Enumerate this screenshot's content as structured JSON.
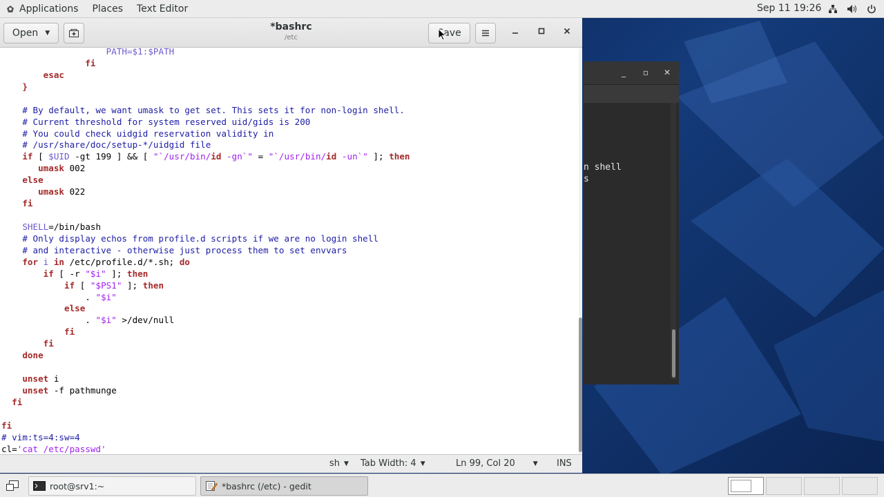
{
  "topbar": {
    "menus": [
      "Applications",
      "Places",
      "Text Editor"
    ],
    "clock": "Sep 11 19:26",
    "tray_icons": [
      "network-icon",
      "volume-icon",
      "power-icon"
    ]
  },
  "gedit": {
    "open_label": "Open",
    "save_label": "Save",
    "title": "*bashrc",
    "subtitle": "/etc",
    "lines": [
      {
        "indent": "                    ",
        "parts": [
          {
            "t": "PATH=",
            "c": "var"
          },
          {
            "t": "$1",
            "c": "var"
          },
          {
            "t": ":",
            "c": "var"
          },
          {
            "t": "$PATH",
            "c": "var"
          }
        ]
      },
      {
        "indent": "                ",
        "parts": [
          {
            "t": "fi",
            "c": "kw"
          }
        ]
      },
      {
        "indent": "        ",
        "parts": [
          {
            "t": "esac",
            "c": "kw"
          }
        ]
      },
      {
        "indent": "    ",
        "parts": [
          {
            "t": "}",
            "c": "kw"
          }
        ]
      },
      {
        "indent": "",
        "parts": []
      },
      {
        "indent": "    ",
        "parts": [
          {
            "t": "# By default, we want umask to get set. This sets it for non-login shell.",
            "c": "cm"
          }
        ]
      },
      {
        "indent": "    ",
        "parts": [
          {
            "t": "# Current threshold for system reserved uid/gids is 200",
            "c": "cm"
          }
        ]
      },
      {
        "indent": "    ",
        "parts": [
          {
            "t": "# You could check uidgid reservation validity in",
            "c": "cm"
          }
        ]
      },
      {
        "indent": "    ",
        "parts": [
          {
            "t": "# /usr/share/doc/setup-*/uidgid file",
            "c": "cm"
          }
        ]
      },
      {
        "indent": "    ",
        "parts": [
          {
            "t": "if",
            "c": "kw"
          },
          {
            "t": " [ ",
            "c": ""
          },
          {
            "t": "$UID",
            "c": "var"
          },
          {
            "t": " -gt 199 ] && [ ",
            "c": ""
          },
          {
            "t": "\"`/usr/bin/",
            "c": "str"
          },
          {
            "t": "id",
            "c": "kw"
          },
          {
            "t": " -gn`\"",
            "c": "str"
          },
          {
            "t": " = ",
            "c": ""
          },
          {
            "t": "\"`/usr/bin/",
            "c": "str"
          },
          {
            "t": "id",
            "c": "kw"
          },
          {
            "t": " -un`\"",
            "c": "str"
          },
          {
            "t": " ]; ",
            "c": ""
          },
          {
            "t": "then",
            "c": "kw"
          }
        ]
      },
      {
        "indent": "       ",
        "parts": [
          {
            "t": "umask",
            "c": "kw"
          },
          {
            "t": " 002",
            "c": ""
          }
        ]
      },
      {
        "indent": "    ",
        "parts": [
          {
            "t": "else",
            "c": "kw"
          }
        ]
      },
      {
        "indent": "       ",
        "parts": [
          {
            "t": "umask",
            "c": "kw"
          },
          {
            "t": " 022",
            "c": ""
          }
        ]
      },
      {
        "indent": "    ",
        "parts": [
          {
            "t": "fi",
            "c": "kw"
          }
        ]
      },
      {
        "indent": "",
        "parts": []
      },
      {
        "indent": "    ",
        "parts": [
          {
            "t": "SHELL",
            "c": "var"
          },
          {
            "t": "=/bin/bash",
            "c": ""
          }
        ]
      },
      {
        "indent": "    ",
        "parts": [
          {
            "t": "# Only display echos from profile.d scripts if we are no login shell",
            "c": "cm"
          }
        ]
      },
      {
        "indent": "    ",
        "parts": [
          {
            "t": "# and interactive - otherwise just process them to set envvars",
            "c": "cm"
          }
        ]
      },
      {
        "indent": "    ",
        "parts": [
          {
            "t": "for",
            "c": "kw"
          },
          {
            "t": " i ",
            "c": "var"
          },
          {
            "t": "in",
            "c": "kw"
          },
          {
            "t": " /etc/profile.d/*.sh; ",
            "c": ""
          },
          {
            "t": "do",
            "c": "kw"
          }
        ]
      },
      {
        "indent": "        ",
        "parts": [
          {
            "t": "if",
            "c": "kw"
          },
          {
            "t": " [ -r ",
            "c": ""
          },
          {
            "t": "\"$i\"",
            "c": "str"
          },
          {
            "t": " ]; ",
            "c": ""
          },
          {
            "t": "then",
            "c": "kw"
          }
        ]
      },
      {
        "indent": "            ",
        "parts": [
          {
            "t": "if",
            "c": "kw"
          },
          {
            "t": " [ ",
            "c": ""
          },
          {
            "t": "\"$PS1\"",
            "c": "str"
          },
          {
            "t": " ]; ",
            "c": ""
          },
          {
            "t": "then",
            "c": "kw"
          }
        ]
      },
      {
        "indent": "                ",
        "parts": [
          {
            "t": ". ",
            "c": ""
          },
          {
            "t": "\"$i\"",
            "c": "str"
          }
        ]
      },
      {
        "indent": "            ",
        "parts": [
          {
            "t": "else",
            "c": "kw"
          }
        ]
      },
      {
        "indent": "                ",
        "parts": [
          {
            "t": ". ",
            "c": ""
          },
          {
            "t": "\"$i\"",
            "c": "str"
          },
          {
            "t": " >/dev/null",
            "c": ""
          }
        ]
      },
      {
        "indent": "            ",
        "parts": [
          {
            "t": "fi",
            "c": "kw"
          }
        ]
      },
      {
        "indent": "        ",
        "parts": [
          {
            "t": "fi",
            "c": "kw"
          }
        ]
      },
      {
        "indent": "    ",
        "parts": [
          {
            "t": "done",
            "c": "kw"
          }
        ]
      },
      {
        "indent": "",
        "parts": []
      },
      {
        "indent": "    ",
        "parts": [
          {
            "t": "unset",
            "c": "kw"
          },
          {
            "t": " i",
            "c": ""
          }
        ]
      },
      {
        "indent": "    ",
        "parts": [
          {
            "t": "unset",
            "c": "kw"
          },
          {
            "t": " -f pathmunge",
            "c": ""
          }
        ]
      },
      {
        "indent": "  ",
        "parts": [
          {
            "t": "fi",
            "c": "kw"
          }
        ]
      },
      {
        "indent": "",
        "parts": []
      },
      {
        "indent": "",
        "parts": [
          {
            "t": "fi",
            "c": "kw"
          }
        ]
      },
      {
        "indent": "",
        "parts": [
          {
            "t": "# vim:ts=4:sw=4",
            "c": "cm"
          }
        ]
      },
      {
        "indent": "",
        "parts": [
          {
            "t": "cl=",
            "c": ""
          },
          {
            "t": "'cat /etc/passwd",
            "c": "str"
          },
          {
            "t": "'",
            "c": "str"
          }
        ]
      }
    ],
    "status": {
      "language": "sh",
      "tab_width": "Tab Width: 4",
      "position": "Ln 99, Col 20",
      "mode": "INS"
    }
  },
  "terminal": {
    "lines": [
      "n shell",
      "s"
    ]
  },
  "taskbar": {
    "tasks": [
      {
        "label": "root@srv1:~"
      },
      {
        "label": "*bashrc (/etc) - gedit"
      }
    ]
  }
}
